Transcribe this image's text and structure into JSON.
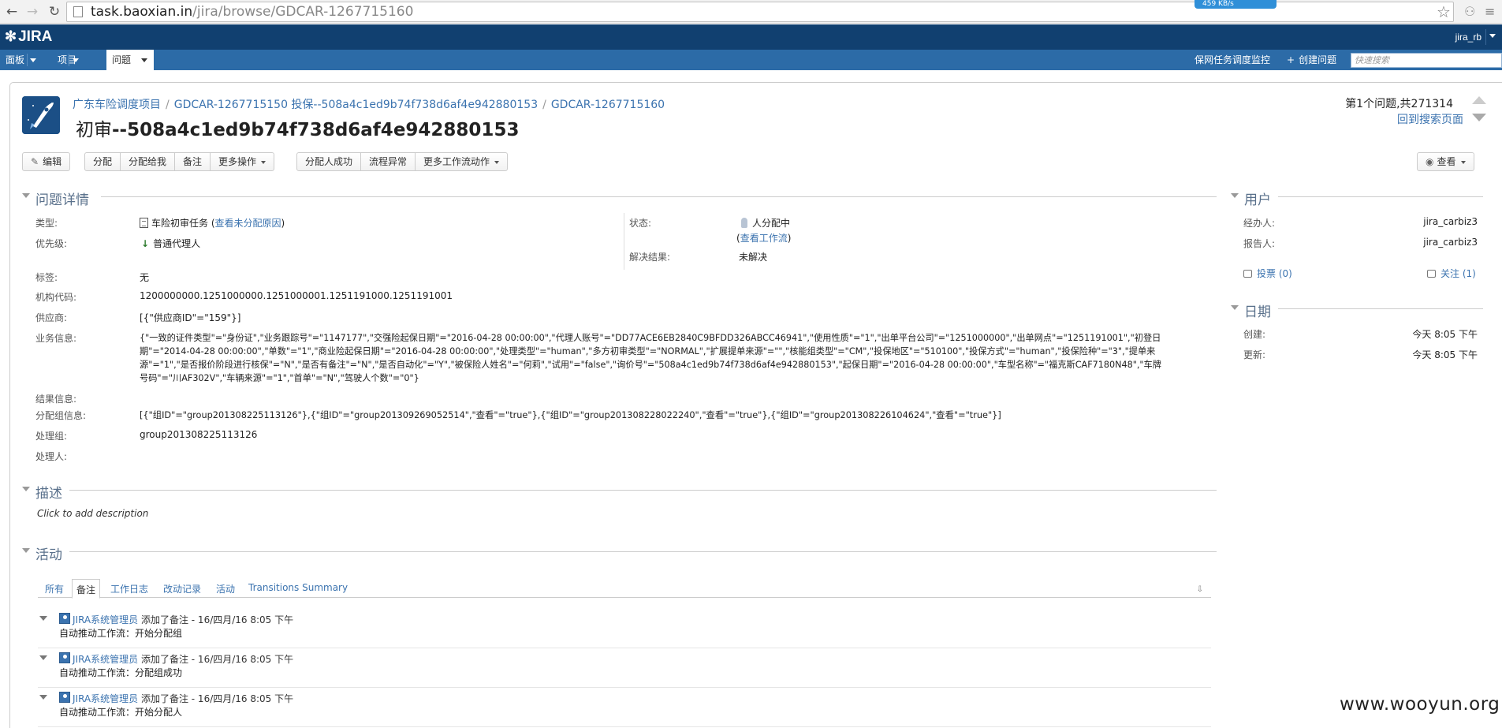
{
  "browser": {
    "url_host": "task.baoxian.in",
    "url_path": "/jira/browse/GDCAR-1267715160",
    "speed": "459 KB/s"
  },
  "topbar": {
    "logo": "JIRA",
    "user": "jira_rb"
  },
  "navbar": {
    "tabs": [
      "面板",
      "项目",
      "问题"
    ],
    "links": [
      "保网任务调度监控",
      "创建问题"
    ],
    "search_placeholder": "快速搜索"
  },
  "breadcrumb": {
    "project": "广东车险调度项目",
    "parent": "GDCAR-1267715150 投保--508a4c1ed9b74f738d6af4e942880153",
    "current": "GDCAR-1267715160"
  },
  "issue": {
    "title_cn": "初审",
    "title_rest": "--508a4c1ed9b74f738d6af4e942880153"
  },
  "pager": {
    "position": "第1个问题,共271314",
    "back": "回到搜索页面"
  },
  "toolbar": {
    "edit": "编辑",
    "assign": "分配",
    "assign_me": "分配给我",
    "comment": "备注",
    "more_actions": "更多操作",
    "assign_success": "分配人成功",
    "flow_error": "流程异常",
    "more_workflow": "更多工作流动作",
    "view": "查看"
  },
  "details": {
    "header": "问题详情",
    "type_label": "类型:",
    "type_value": "车险初审任务",
    "type_link": "查看未分配原因",
    "priority_label": "优先级:",
    "priority_value": "普通代理人",
    "status_label": "状态:",
    "status_value": "人分配中",
    "status_link": "查看工作流",
    "resolution_label": "解决结果:",
    "resolution_value": "未解决",
    "labels_label": "标签:",
    "labels_value": "无",
    "org_label": "机构代码:",
    "org_value": "1200000000.1251000000.1251000001.1251191000.1251191001",
    "supplier_label": "供应商:",
    "supplier_value": "[{\"供应商ID\"=\"159\"}]",
    "business_label": "业务信息:",
    "business_value": "{\"一致的证件类型\"=\"身份证\",\"业务跟踪号\"=\"1147177\",\"交强险起保日期\"=\"2016-04-28 00:00:00\",\"代理人账号\"=\"DD77ACE6EB2840C9BFDD326ABCC46941\",\"使用性质\"=\"1\",\"出单平台公司\"=\"1251000000\",\"出单网点\"=\"1251191001\",\"初登日期\"=\"2014-04-28 00:00:00\",\"单数\"=\"1\",\"商业险起保日期\"=\"2016-04-28 00:00:00\",\"处理类型\"=\"human\",\"多方初审类型\"=\"NORMAL\",\"扩展提单来源\"=\"\",\"核能组类型\"=\"CM\",\"投保地区\"=\"510100\",\"投保方式\"=\"human\",\"投保险种\"=\"3\",\"提单来源\"=\"1\",\"是否报价阶段进行核保\"=\"N\",\"是否有备注\"=\"N\",\"是否自动化\"=\"Y\",\"被保险人姓名\"=\"何莉\",\"试用\"=\"false\",\"询价号\"=\"508a4c1ed9b74f738d6af4e942880153\",\"起保日期\"=\"2016-04-28 00:00:00\",\"车型名称\"=\"福克斯CAF7180N48\",\"车牌号码\"=\"川AF302V\",\"车辆来源\"=\"1\",\"首单\"=\"N\",\"驾驶人个数\"=\"0\"}",
    "result_label": "结果信息:",
    "group_info_label": "分配组信息:",
    "group_info_value": "[{\"组ID\"=\"group201308225113126\"},{\"组ID\"=\"group201309269052514\",\"查看\"=\"true\"},{\"组ID\"=\"group201308228022240\",\"查看\"=\"true\"},{\"组ID\"=\"group201308226104624\",\"查看\"=\"true\"}]",
    "handle_group_label": "处理组:",
    "handle_group_value": "group201308225113126",
    "handler_label": "处理人:"
  },
  "description": {
    "header": "描述",
    "placeholder": "Click to add description"
  },
  "activity": {
    "header": "活动",
    "tabs": [
      "所有",
      "备注",
      "工作日志",
      "改动记录",
      "活动",
      "Transitions Summary"
    ],
    "comments": [
      {
        "author": "JIRA系统管理员",
        "meta": "添加了备注 - 16/四月/16 8:05 下午",
        "body": "自动推动工作流：开始分配组"
      },
      {
        "author": "JIRA系统管理员",
        "meta": "添加了备注 - 16/四月/16 8:05 下午",
        "body": "自动推动工作流：分配组成功"
      },
      {
        "author": "JIRA系统管理员",
        "meta": "添加了备注 - 16/四月/16 8:05 下午",
        "body": "自动推动工作流：开始分配人"
      }
    ]
  },
  "people": {
    "header": "用户",
    "assignee_label": "经办人:",
    "assignee_value": "jira_carbiz3",
    "reporter_label": "报告人:",
    "reporter_value": "jira_carbiz3",
    "votes": "投票 (0)",
    "watchers": "关注 (1)"
  },
  "dates": {
    "header": "日期",
    "created_label": "创建:",
    "created_value": "今天 8:05 下午",
    "updated_label": "更新:",
    "updated_value": "今天 8:05 下午"
  },
  "watermark": "www.wooyun.org",
  "colors": {
    "jira_header": "#114070",
    "jira_nav": "#2c6ba7",
    "link": "#3b73af"
  }
}
